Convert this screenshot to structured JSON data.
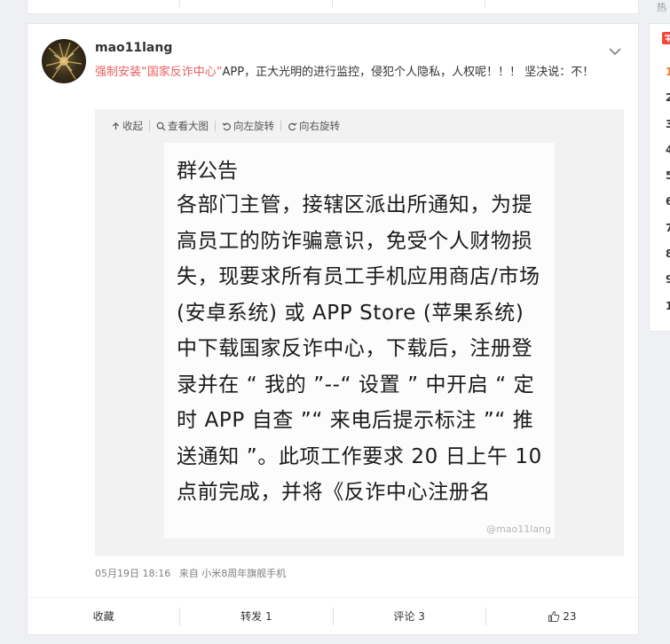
{
  "post": {
    "username": "mao11lang",
    "text_highlight_1": "强制安装",
    "text_highlight_2": "“国家反诈中心”",
    "text_rest": "APP，正大光明的进行监控，侵犯个人隐私，人权呢！！！ 坚决说：不！",
    "timestamp": "05月19日 18:16",
    "source_prefix": "来自",
    "source_device": "小米8周年旗舰手机"
  },
  "media_toolbar": {
    "collapse": "收起",
    "view_large": "查看大图",
    "rotate_left": "向左旋转",
    "rotate_right": "向右旋转"
  },
  "notice_image": {
    "title": "群公告",
    "body": "各部门主管，接辖区派出所通知，为提高员工的防诈骗意识，免受个人财物损失，现要求所有员工手机应用商店/市场(安卓系统) 或 APP Store (苹果系统) 中下载国家反诈中心，下载后，注册登录并在 “ 我的 ”--“ 设置 ” 中开启 “ 定时 APP 自查 ”“ 来电后提示标注 ”“ 推送通知 ”。此项工作要求 20 日上午 10 点前完成，并将《反诈中心注册名",
    "watermark": "@mao11lang"
  },
  "actions": {
    "favorite": "收藏",
    "repost": "转发 1",
    "comment": "评论 3",
    "like": "23"
  },
  "sidebar": {
    "numbers": [
      "1",
      "2",
      "3",
      "4",
      "5",
      "6",
      "7",
      "8",
      "9",
      "1"
    ],
    "top_stub": "热"
  },
  "colors": {
    "highlight": "#eb5d5d",
    "hot_rank": "#f7731c"
  }
}
